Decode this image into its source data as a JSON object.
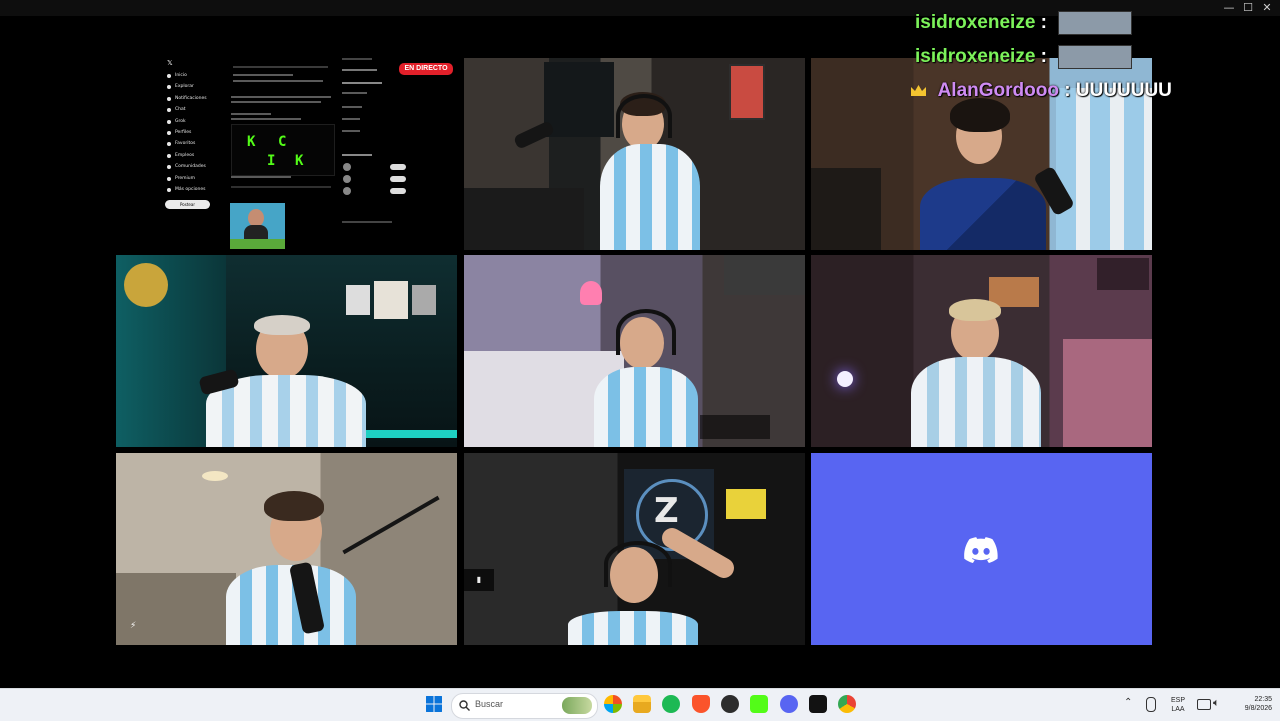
{
  "window": {
    "controls": {
      "minimize": "—",
      "maximize": "☐",
      "close": "✕"
    }
  },
  "stream": {
    "live_badge": "EN DIRECTO",
    "x_nav": [
      "Inicio",
      "Explorar",
      "Notificaciones",
      "Chat",
      "Grok",
      "Perfiles",
      "Favoritos",
      "Empleos",
      "Comunidades",
      "Premium",
      "Más opciones"
    ],
    "x_post_button": "Postear",
    "kick_letters": [
      "K",
      "C",
      "I",
      "K"
    ],
    "tiles": [
      {
        "name": "browser-capture-tile"
      },
      {
        "name": "webcam-tile-1"
      },
      {
        "name": "webcam-tile-2"
      },
      {
        "name": "webcam-tile-3"
      },
      {
        "name": "webcam-tile-4"
      },
      {
        "name": "webcam-tile-5"
      },
      {
        "name": "webcam-tile-6"
      },
      {
        "name": "webcam-tile-7"
      }
    ],
    "colors": {
      "speaking_border": "#6fdc74",
      "discord": "#5865f2",
      "live": "#e2202a"
    }
  },
  "chat": [
    {
      "user": "isidroxeneize",
      "separator": ":",
      "color": "#7cf25a",
      "has_image": true
    },
    {
      "user": "isidroxeneize",
      "separator": ":",
      "color": "#7cf25a",
      "has_image": true
    },
    {
      "user": "AlanGordooo",
      "separator": ":",
      "message": "UUUUUUU",
      "color": "#cf8bf3",
      "crown": true
    }
  ],
  "taskbar": {
    "search_placeholder": "Buscar",
    "language": "ESP",
    "layout": "LAA",
    "time": "22:35",
    "date": "9/8/2026",
    "apps": [
      "start-icon",
      "search-icon",
      "widgets-icon",
      "copilot-icon",
      "file-explorer-icon",
      "spotify-icon",
      "brave-icon",
      "obs-icon",
      "kick-icon",
      "discord-icon",
      "epic-icon",
      "chrome-icon"
    ]
  }
}
